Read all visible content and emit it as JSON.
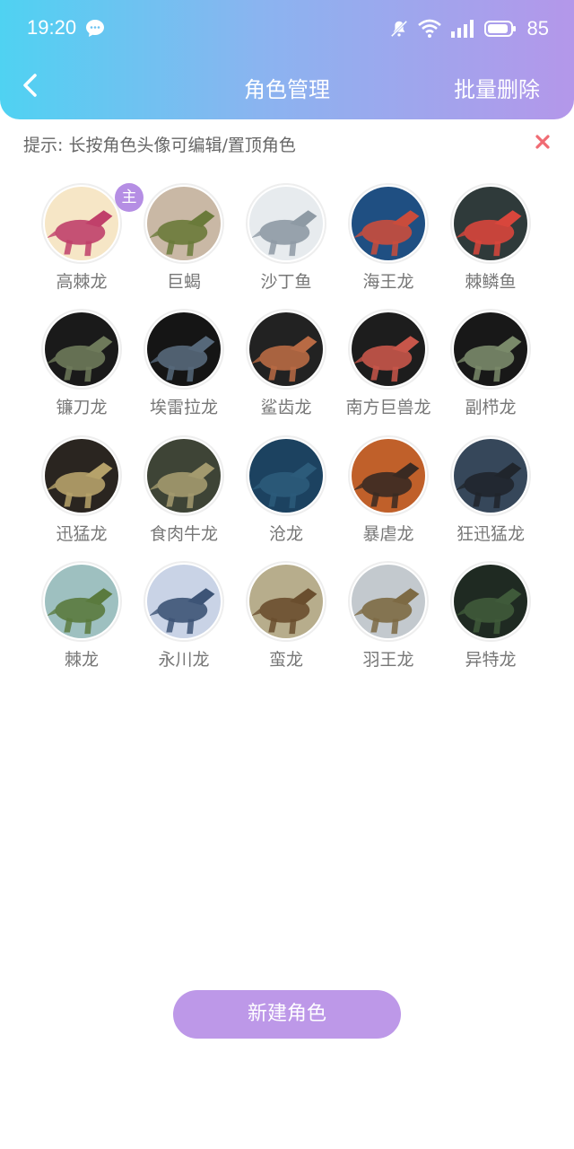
{
  "status": {
    "time": "19:20",
    "battery": "85"
  },
  "header": {
    "title": "角色管理",
    "batch_delete": "批量删除"
  },
  "hint": {
    "text": "提示: 长按角色头像可编辑/置顶角色"
  },
  "roles": [
    {
      "name": "高棘龙",
      "main": true,
      "bg": "#f6e6c6",
      "fg": "#c0406a"
    },
    {
      "name": "巨蝎",
      "main": false,
      "bg": "#c9b8a5",
      "fg": "#6a7a3a"
    },
    {
      "name": "沙丁鱼",
      "main": false,
      "bg": "#e7ebee",
      "fg": "#8e9aa4"
    },
    {
      "name": "海王龙",
      "main": false,
      "bg": "#1f4f82",
      "fg": "#c94c3c"
    },
    {
      "name": "棘鳞鱼",
      "main": false,
      "bg": "#2f3a3a",
      "fg": "#d8463c"
    },
    {
      "name": "镰刀龙",
      "main": false,
      "bg": "#1a1a1a",
      "fg": "#6e7a5a"
    },
    {
      "name": "埃雷拉龙",
      "main": false,
      "bg": "#151515",
      "fg": "#56687a"
    },
    {
      "name": "鲨齿龙",
      "main": false,
      "bg": "#222222",
      "fg": "#b86a44"
    },
    {
      "name": "南方巨兽龙",
      "main": false,
      "bg": "#1d1d1d",
      "fg": "#c8564a"
    },
    {
      "name": "副栉龙",
      "main": false,
      "bg": "#181818",
      "fg": "#7a8a6a"
    },
    {
      "name": "迅猛龙",
      "main": false,
      "bg": "#2a2520",
      "fg": "#b6a26a"
    },
    {
      "name": "食肉牛龙",
      "main": false,
      "bg": "#3e4436",
      "fg": "#a39a6e"
    },
    {
      "name": "沧龙",
      "main": false,
      "bg": "#1c4260",
      "fg": "#2c5b7a"
    },
    {
      "name": "暴虐龙",
      "main": false,
      "bg": "#c0602a",
      "fg": "#3a2a22"
    },
    {
      "name": "狂迅猛龙",
      "main": false,
      "bg": "#36475a",
      "fg": "#20252c"
    },
    {
      "name": "棘龙",
      "main": false,
      "bg": "#9ec0c0",
      "fg": "#5a7a3e"
    },
    {
      "name": "永川龙",
      "main": false,
      "bg": "#c9d3e6",
      "fg": "#3d5476"
    },
    {
      "name": "蛮龙",
      "main": false,
      "bg": "#b7ad8c",
      "fg": "#6a4e2e"
    },
    {
      "name": "羽王龙",
      "main": false,
      "bg": "#c3c9ce",
      "fg": "#7d6a44"
    },
    {
      "name": "异特龙",
      "main": false,
      "bg": "#1f2a22",
      "fg": "#3f5a3a"
    }
  ],
  "main_badge": "主",
  "new_role_button": "新建角色"
}
